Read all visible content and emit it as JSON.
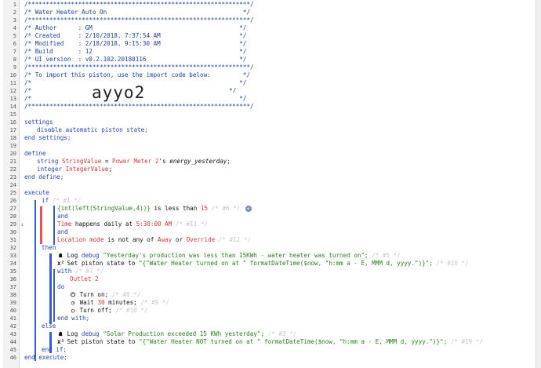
{
  "gutter_lines": [
    "1",
    "2",
    "3",
    "4",
    "5",
    "6",
    "7",
    "8",
    "9",
    "10",
    "11",
    "12",
    "13",
    "14",
    "15",
    "16",
    "17",
    "18",
    "19",
    "20",
    "21",
    "22",
    "23",
    "24",
    "25",
    "26",
    "27",
    "28",
    "29",
    "30",
    "31",
    "32",
    "33",
    "34",
    "35",
    "36",
    "37",
    "38",
    "39",
    "40",
    "41",
    "42",
    "43",
    "44",
    "45",
    "46"
  ],
  "header": {
    "border": "/**************************************************************/",
    "title_line": "/* Water Heater Auto On                                      */",
    "author_line": "/* Author      : GM                                         */",
    "created_line": "/* Created     : 2/10/2018, 7:37:54 AM                      */",
    "modified_line": "/* Modified    : 2/18/2018, 9:15:30 AM                      */",
    "build_line": "/* Build       : 12                                         */",
    "ui_line": "/* UI version  : v0.2.102.20180116                          */",
    "import_line": "/* To import this piston, use the import code below:         */",
    "blank_line": "/*                                                          */",
    "code_open": "/*",
    "code_close": "*/",
    "import_code": "ayyo2"
  },
  "settings": {
    "open": "settings",
    "item": "disable automatic piston state;",
    "close": "end settings;"
  },
  "define": {
    "open": "define",
    "v1_type": "string",
    "v1_name": "StringValue",
    "v1_eq": " = ",
    "v1_device": "Power Meter 2",
    "v1_mid": "'s ",
    "v1_attr": "energy_yesterday",
    "v1_end": ";",
    "v2_type": "integer",
    "v2_name": "IntegerValue",
    "v2_end": ";",
    "close": "end define;"
  },
  "execute": {
    "open": "execute",
    "if_kw": "if",
    "if_cmt": " /* #1 */",
    "c1_expr": "{int(left(StringValue,4))}",
    "c1_op": " is less than ",
    "c1_val": "15",
    "c1_cmt": " /* #6 */",
    "c1_plus": "+",
    "and1": "and",
    "c2_subj": "Time",
    "c2_op": " happens daily at ",
    "c2_val": "5:30:00 AM",
    "c2_cmt": " /* #11 */",
    "and2": "and",
    "c3_subj": "Location mode",
    "c3_op": " is not any of ",
    "c3_v1": "Away",
    "c3_or": " or ",
    "c3_v2": "Override",
    "c3_cmt": " /* #12 */",
    "then": "then",
    "t1_kw": "Log ",
    "t1_level": "debug",
    "t1_str": " \"Yesterday's production was less than 15KWh - water heater was turned on\";",
    "t1_cmt": " /* #5 */",
    "t2_kw": "Set piston state to ",
    "t2_str": "\"{\"Water Heater turned on at \" formatDateTime($now, \"h:mm a - E, MMM d, yyyy.\")}\";",
    "t2_cmt": " /* #20 */",
    "with_kw": "with",
    "with_cmt": " /* #7 */",
    "with_dev": "Outlet 2",
    "do_kw": "do",
    "d1": "Turn on;",
    "d1_cmt": " /* #8 */",
    "d2_a": "Wait ",
    "d2_num": "30",
    "d2_b": " minutes;",
    "d2_cmt": " /* #9 */",
    "d3": "Turn off;",
    "d3_cmt": " /* #10 */",
    "end_with": "end with;",
    "else_kw": "else",
    "e1_kw": "Log ",
    "e1_level": "debug",
    "e1_str": " \"Solar Production exceeded 15 KWh yesterday\";",
    "e1_cmt": " /* #3 */",
    "e2_kw": "Set piston state to ",
    "e2_str": "\"{\"Water Heater NOT turned on at \" formatDateTime($now, \"h:mm a - E, MMM d, yyyy.\")}\";",
    "e2_cmt": " /* #19 */",
    "end_if": "end if;",
    "close": "end execute;"
  },
  "colors": {
    "keyword": "#2b46b3",
    "variable": "#c2373b",
    "string": "#2b7d20",
    "comment": "#c7c7c7",
    "bracket": "#3a5bd6",
    "red": "#e05757"
  }
}
